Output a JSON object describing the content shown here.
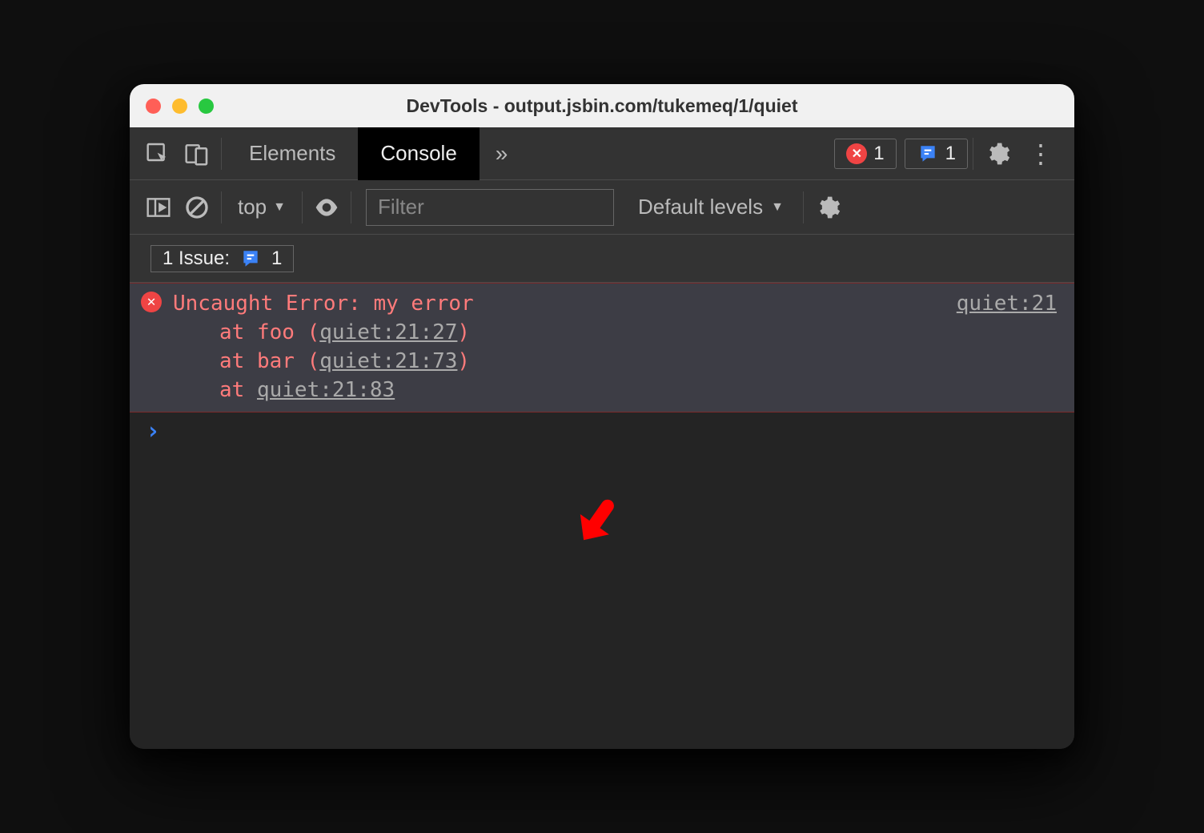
{
  "window": {
    "title": "DevTools - output.jsbin.com/tukemeq/1/quiet"
  },
  "tabs": {
    "elements": "Elements",
    "console": "Console"
  },
  "badges": {
    "errorCount": "1",
    "issueCount": "1"
  },
  "toolbar": {
    "context": "top",
    "filterPlaceholder": "Filter",
    "levels": "Default levels"
  },
  "issuesbar": {
    "prefix": "1 Issue:",
    "count": "1"
  },
  "error": {
    "title": "Uncaught Error: my error",
    "sourceLink": "quiet:21",
    "stack": [
      {
        "prefix": "at foo (",
        "link": "quiet:21:27",
        "suffix": ")"
      },
      {
        "prefix": "at bar (",
        "link": "quiet:21:73",
        "suffix": ")"
      },
      {
        "prefix": "at ",
        "link": "quiet:21:83",
        "suffix": ""
      }
    ]
  },
  "prompt": "›"
}
